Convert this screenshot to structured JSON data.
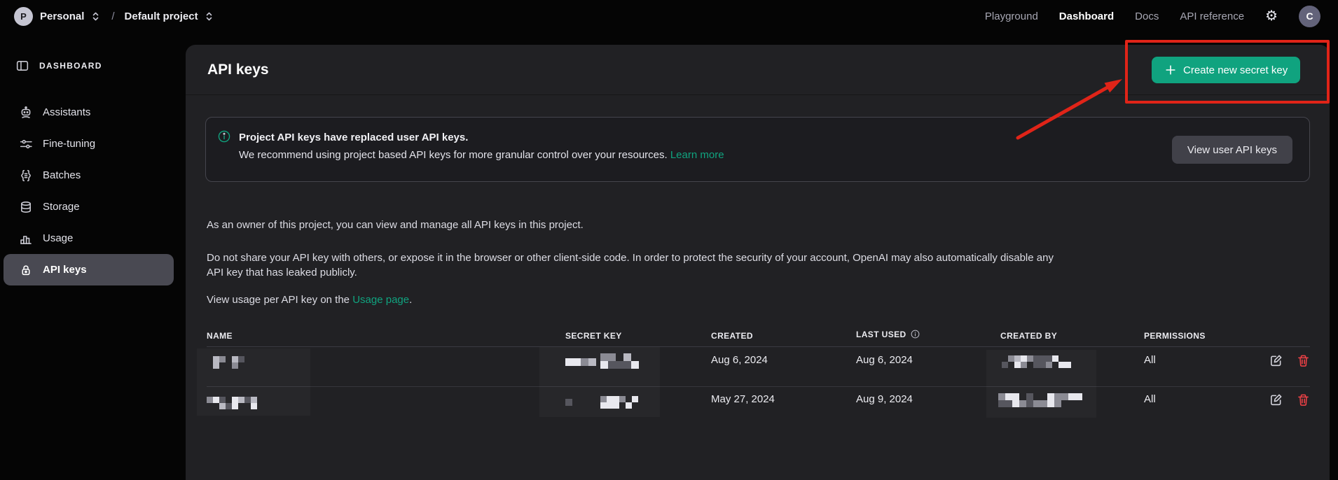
{
  "topbar": {
    "org": {
      "initial": "P",
      "name": "Personal"
    },
    "breadcrumb_separator": "/",
    "project": {
      "name": "Default project"
    },
    "nav": {
      "playground": "Playground",
      "dashboard": "Dashboard",
      "docs": "Docs",
      "api_reference": "API reference"
    },
    "user_initial": "C"
  },
  "sidebar": {
    "section_label": "DASHBOARD",
    "items": [
      {
        "label": "Assistants",
        "icon": "assistants-icon",
        "active": false
      },
      {
        "label": "Fine-tuning",
        "icon": "fine-tuning-icon",
        "active": false
      },
      {
        "label": "Batches",
        "icon": "batches-icon",
        "active": false
      },
      {
        "label": "Storage",
        "icon": "storage-icon",
        "active": false
      },
      {
        "label": "Usage",
        "icon": "usage-icon",
        "active": false
      },
      {
        "label": "API keys",
        "icon": "api-keys-icon",
        "active": true
      }
    ]
  },
  "main": {
    "title": "API keys",
    "create_button_label": "Create new secret key",
    "banner": {
      "title": "Project API keys have replaced user API keys.",
      "body": "We recommend using project based API keys for more granular control over your resources.",
      "link_label": "Learn more",
      "button_label": "View user API keys"
    },
    "paragraphs": {
      "p1": "As an owner of this project, you can view and manage all API keys in this project.",
      "p2": "Do not share your API key with others, or expose it in the browser or other client-side code. In order to protect the security of your account, OpenAI may also automatically disable any API key that has leaked publicly.",
      "p3_prefix": "View usage per API key on the ",
      "p3_link": "Usage page",
      "p3_suffix": "."
    },
    "table": {
      "columns": [
        "NAME",
        "SECRET KEY",
        "CREATED",
        "LAST USED",
        "CREATED BY",
        "PERMISSIONS"
      ],
      "rows": [
        {
          "name_redacted": true,
          "secret_key_redacted": true,
          "created": "Aug 6, 2024",
          "last_used": "Aug 6, 2024",
          "created_by_redacted": true,
          "permissions": "All"
        },
        {
          "name_redacted": true,
          "secret_key_redacted": true,
          "created": "May 27, 2024",
          "last_used": "Aug 9, 2024",
          "created_by_redacted": true,
          "permissions": "All"
        }
      ]
    }
  },
  "colors": {
    "accent_green": "#10a37f",
    "annotation_red": "#e02418",
    "trash_red": "#ef4146"
  }
}
